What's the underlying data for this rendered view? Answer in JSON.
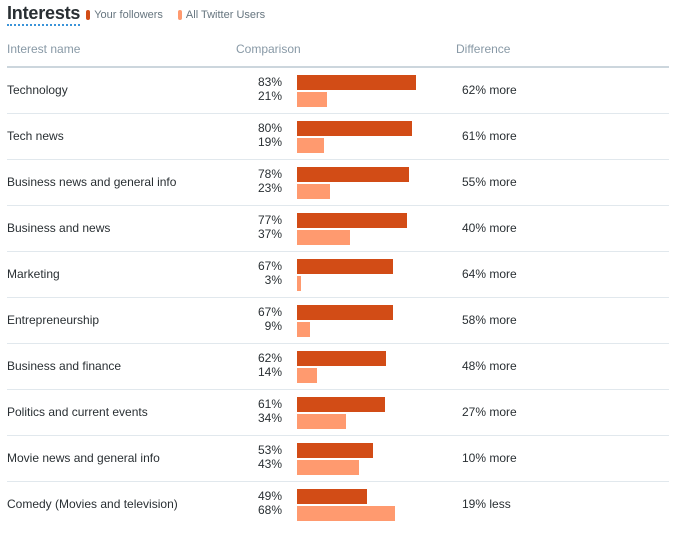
{
  "title": "Interests",
  "legend": [
    {
      "label": "Your followers",
      "color": "#d24c16"
    },
    {
      "label": "All Twitter Users",
      "color": "#ff9a6f"
    }
  ],
  "columns": {
    "name": "Interest name",
    "comparison": "Comparison",
    "difference": "Difference"
  },
  "chart_data": {
    "type": "bar",
    "title": "Interests",
    "orientation": "horizontal",
    "categories": [
      "Technology",
      "Tech news",
      "Business news and general info",
      "Business and news",
      "Marketing",
      "Entrepreneurship",
      "Business and finance",
      "Politics and current events",
      "Movie news and general info",
      "Comedy (Movies and television)"
    ],
    "series": [
      {
        "name": "Your followers",
        "color": "#d24c16",
        "values": [
          83,
          80,
          78,
          77,
          67,
          67,
          62,
          61,
          53,
          49
        ]
      },
      {
        "name": "All Twitter Users",
        "color": "#ff9a6f",
        "values": [
          21,
          19,
          23,
          37,
          3,
          9,
          14,
          34,
          43,
          68
        ]
      }
    ],
    "difference": [
      "62% more",
      "61% more",
      "55% more",
      "40% more",
      "64% more",
      "58% more",
      "48% more",
      "27% more",
      "10% more",
      "19% less"
    ],
    "xlabel": "",
    "ylabel": "",
    "xlim": [
      0,
      100
    ],
    "unit": "%",
    "legend": "top-left",
    "grid": false
  }
}
